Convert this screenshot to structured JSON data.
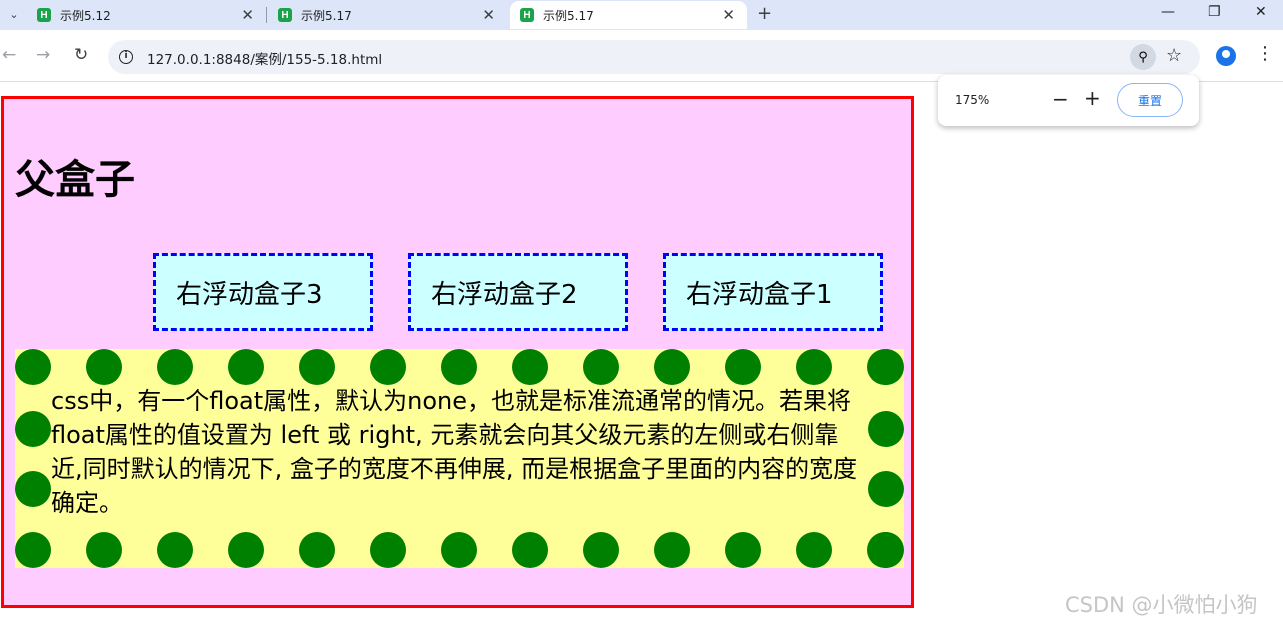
{
  "tabs": [
    {
      "label": "示例5.12",
      "icon": "html-file-icon"
    },
    {
      "label": "示例5.17",
      "icon": "html-file-icon"
    },
    {
      "label": "示例5.17",
      "icon": "html-file-icon",
      "active": true
    }
  ],
  "favicon_glyph": "H",
  "tab_close_glyph": "✕",
  "new_tab_glyph": "+",
  "chevron_glyph": "⌄",
  "window_controls": {
    "minimize": "—",
    "restore": "❐",
    "close": "✕"
  },
  "nav": {
    "back": "←",
    "forward": "→",
    "reload": "↻"
  },
  "address_bar": {
    "url": "127.0.0.1:8848/案例/155-5.18.html",
    "info_glyph": "i"
  },
  "toolbar_icons": {
    "zoom": "⚲",
    "star": "☆",
    "menu": "⋮"
  },
  "zoom_popup": {
    "percent": "175%",
    "minus": "−",
    "plus": "+",
    "reset": "重置"
  },
  "page": {
    "heading": "父盒子",
    "float_boxes": [
      "右浮动盒子3",
      "右浮动盒子2",
      "右浮动盒子1"
    ],
    "paragraph": "css中，有一个float属性，默认为none，也就是标准流通常的情况。若果将float属性的值设置为 left 或 right, 元素就会向其父级元素的左侧或右侧靠近,同时默认的情况下, 盒子的宽度不再伸展, 而是根据盒子里面的内容的宽度确定。"
  },
  "colors": {
    "parent_bg": "#ffccff",
    "parent_border": "#ff0000",
    "float_bg": "#ccffff",
    "float_border": "#0000ff",
    "text_bg": "#ffff99",
    "dot": "#008000"
  },
  "watermark": "CSDN @小微怕小狗"
}
